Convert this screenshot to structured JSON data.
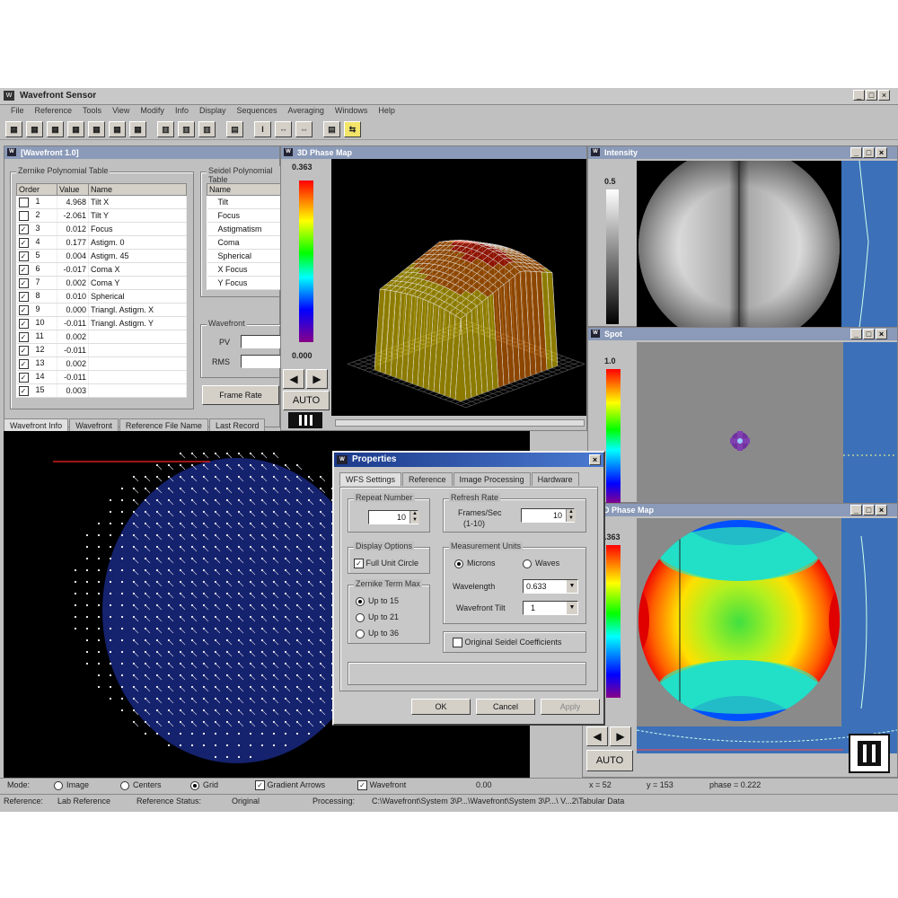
{
  "app": {
    "title": "Wavefront Sensor"
  },
  "menu": [
    "File",
    "Reference",
    "Tools",
    "View",
    "Modify",
    "Info",
    "Display",
    "Sequences",
    "Averaging",
    "Windows",
    "Help"
  ],
  "toolbar": [
    "▦",
    "▦",
    "▦",
    "▦",
    "▦",
    "▦",
    "▦",
    "▥",
    "▥",
    "▥",
    "▤",
    "I",
    "⇔",
    "⇔",
    "▤",
    "⇆"
  ],
  "zernike": {
    "title": "[Wavefront 1.0]",
    "group_label": "Zernike Polynomial Table",
    "headers": [
      "Order",
      "Value",
      "Name"
    ],
    "rows": [
      {
        "checked": false,
        "order": "1",
        "value": "4.968",
        "name": "Tilt X"
      },
      {
        "checked": false,
        "order": "2",
        "value": "-2.061",
        "name": "Tilt Y"
      },
      {
        "checked": true,
        "order": "3",
        "value": "0.012",
        "name": "Focus"
      },
      {
        "checked": true,
        "order": "4",
        "value": "0.177",
        "name": "Astigm. 0"
      },
      {
        "checked": true,
        "order": "5",
        "value": "0.004",
        "name": "Astigm. 45"
      },
      {
        "checked": true,
        "order": "6",
        "value": "-0.017",
        "name": "Coma X"
      },
      {
        "checked": true,
        "order": "7",
        "value": "0.002",
        "name": "Coma Y"
      },
      {
        "checked": true,
        "order": "8",
        "value": "0.010",
        "name": "Spherical"
      },
      {
        "checked": true,
        "order": "9",
        "value": "0.000",
        "name": "Triangl. Astigm. X"
      },
      {
        "checked": true,
        "order": "10",
        "value": "-0.011",
        "name": "Triangl. Astigm. Y"
      },
      {
        "checked": true,
        "order": "11",
        "value": "0.002",
        "name": ""
      },
      {
        "checked": true,
        "order": "12",
        "value": "-0.011",
        "name": ""
      },
      {
        "checked": true,
        "order": "13",
        "value": "0.002",
        "name": ""
      },
      {
        "checked": true,
        "order": "14",
        "value": "-0.011",
        "name": ""
      },
      {
        "checked": true,
        "order": "15",
        "value": "0.003",
        "name": ""
      }
    ],
    "seidel_label": "Seidel Polynomial Table",
    "seidel_header": "Name",
    "seidel_rows": [
      "Tilt",
      "Focus",
      "Astigmatism",
      "Coma",
      "Spherical",
      "X Focus",
      "Y Focus"
    ],
    "wavefront_label": "Wavefront",
    "pv_label": "PV",
    "rms_label": "RMS",
    "frame_button": "Frame Rate"
  },
  "left_tabs": [
    "Wavefront Info",
    "Wavefront",
    "Reference File Name",
    "Last Record"
  ],
  "phase3d": {
    "title": "3D Phase Map",
    "scale_max": "0.363",
    "scale_min": "0.000",
    "auto": "AUTO"
  },
  "intensity": {
    "title": "Intensity",
    "scale": "0.5"
  },
  "spot": {
    "title": "Spot",
    "scale": "1.0"
  },
  "phase2d": {
    "title": "2D Phase Map",
    "scale": ".363",
    "auto": "AUTO"
  },
  "dialog": {
    "title": "Properties",
    "tabs": [
      "WFS Settings",
      "Reference",
      "Image Processing",
      "Hardware"
    ],
    "repeat_label": "Repeat Number",
    "repeat_value": "10",
    "refresh_label": "Refresh Rate",
    "frames_label": "Frames/Sec",
    "frames_range": "(1-10)",
    "frames_value": "10",
    "display_label": "Display Options",
    "full_circle": "Full Unit Circle",
    "zernike_max_label": "Zernike Term Max",
    "zernike_opts": [
      "Up to 15",
      "Up to 21",
      "Up to 36"
    ],
    "units_label": "Measurement Units",
    "microns": "Microns",
    "waves": "Waves",
    "wavelength_label": "Wavelength",
    "wavelength_value": "0.633",
    "wavefront_tilt_label": "Wavefront Tilt",
    "wavefront_tilt_value": "1",
    "original_seidel": "Original Seidel Coefficients",
    "ok": "OK",
    "cancel": "Cancel",
    "apply": "Apply"
  },
  "status1": {
    "mode_label": "Mode:",
    "opts": [
      "Image",
      "Centers",
      "Grid",
      "Gradient Arrows",
      "Wavefront"
    ],
    "value": "0.00",
    "coords": [
      "x = 52",
      "y = 153",
      "phase = 0.222"
    ]
  },
  "status2": {
    "reference_label": "Reference:",
    "reference_value": "Lab Reference",
    "ref_status_label": "Reference Status:",
    "ref_status_value": "Original",
    "processing_label": "Processing:",
    "processing_value": "C:\\Wavefront\\System 3\\P...\\Wavefront\\System 3\\P...\\ V...2\\Tabular Data"
  },
  "colors": {
    "window_bg": "#c0c0c0",
    "title_blue": "#1c3a8a"
  }
}
